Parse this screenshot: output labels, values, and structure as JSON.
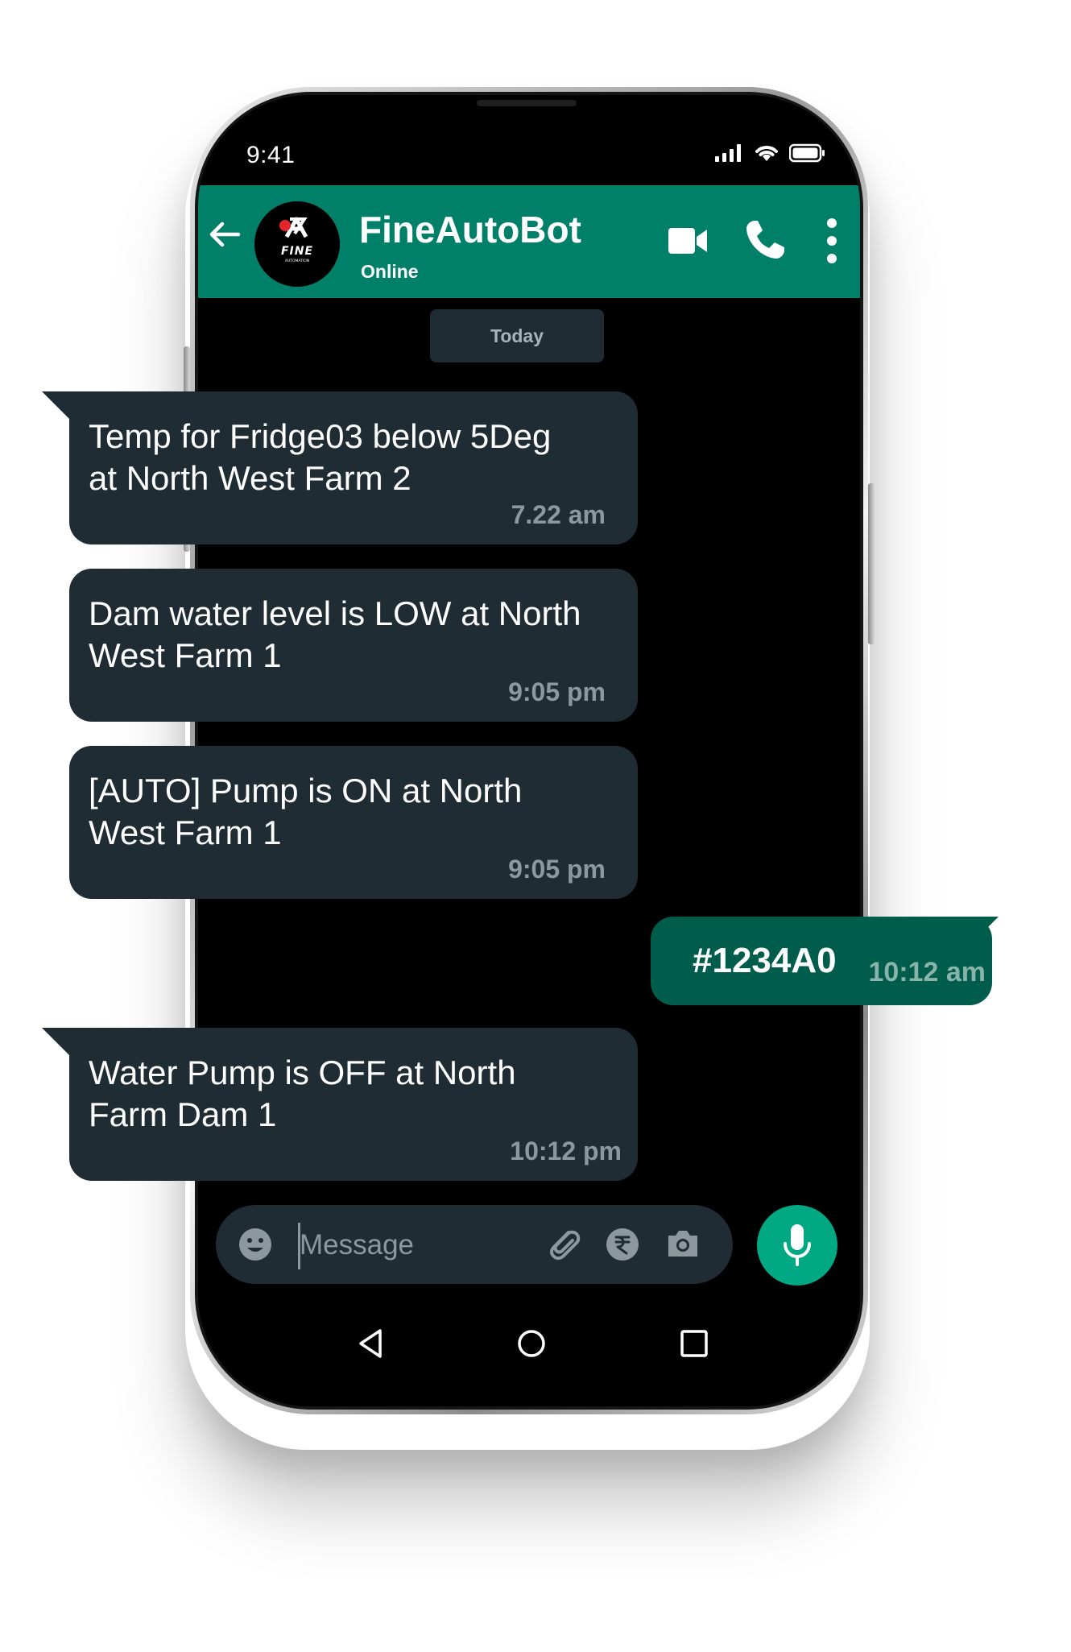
{
  "status_bar": {
    "time": "9:41"
  },
  "header": {
    "contact_name": "FineAutoBot",
    "contact_status": "Online",
    "avatar_logo_text": "FINE",
    "avatar_logo_subtext": "AUTOMATION",
    "icons": [
      "back-arrow-icon",
      "video-call-icon",
      "voice-call-icon",
      "more-options-icon"
    ],
    "accent_color": "#008069"
  },
  "date_chip": "Today",
  "messages": [
    {
      "direction": "incoming",
      "text": "Temp for Fridge03 below 5Deg\nat North West Farm 2",
      "time": "7.22 am"
    },
    {
      "direction": "incoming",
      "text": "Dam water level is LOW at North\nWest Farm 1",
      "time": "9:05 pm"
    },
    {
      "direction": "incoming",
      "text": "[AUTO] Pump is ON at North\nWest Farm 1",
      "time": "9:05 pm"
    },
    {
      "direction": "outgoing",
      "text": "#1234A0",
      "time": "10:12 am"
    },
    {
      "direction": "incoming",
      "text": "Water Pump is OFF at North\nFarm Dam 1",
      "time": "10:12 pm"
    }
  ],
  "input": {
    "placeholder": "Message",
    "icons": [
      "emoji-icon",
      "attach-icon",
      "payment-rupee-icon",
      "camera-icon",
      "mic-icon"
    ]
  },
  "colors": {
    "incoming_bubble": "#202c33",
    "outgoing_bubble": "#005c4b",
    "screen_background": "#000000",
    "mic_button": "#00a884"
  }
}
